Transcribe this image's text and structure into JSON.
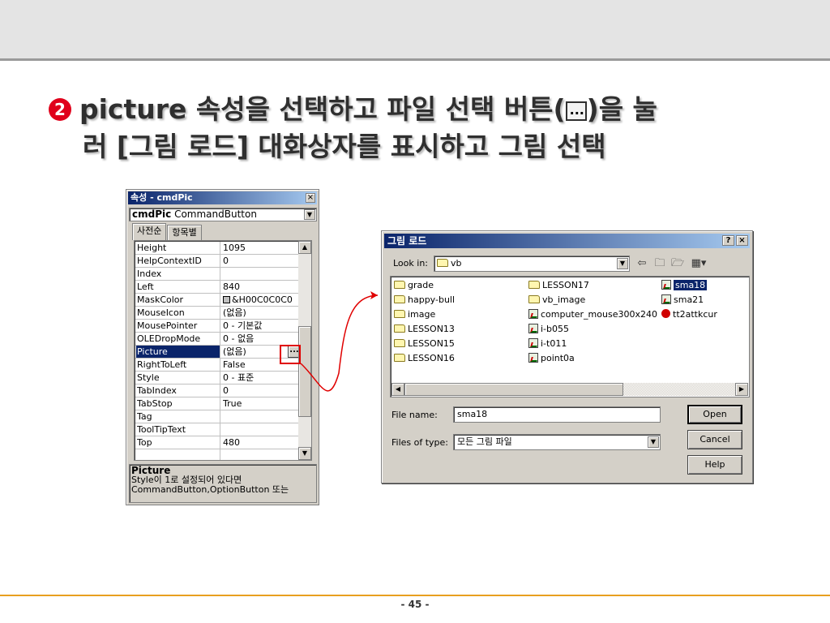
{
  "slide": {
    "bullet": "2",
    "title_part1": "picture 속성을 선택하고 파일 선택 버튼(",
    "title_part2": ")을 눌",
    "title_line2": "러 [그림 로드] 대화상자를 표시하고 그림 선택",
    "page_number": "- 45 -"
  },
  "props_window": {
    "title": "속성 - cmdPic",
    "close": "×",
    "object_name": "cmdPic",
    "object_type": "CommandButton",
    "tabs": [
      "사전순",
      "항목별"
    ],
    "properties": [
      {
        "name": "Height",
        "value": "1095"
      },
      {
        "name": "HelpContextID",
        "value": "0"
      },
      {
        "name": "Index",
        "value": ""
      },
      {
        "name": "Left",
        "value": "840"
      },
      {
        "name": "MaskColor",
        "value": "&H00C0C0C0"
      },
      {
        "name": "MouseIcon",
        "value": "(없음)"
      },
      {
        "name": "MousePointer",
        "value": "0 - 기본값"
      },
      {
        "name": "OLEDropMode",
        "value": "0 - 없음"
      },
      {
        "name": "Picture",
        "value": "(없음)"
      },
      {
        "name": "RightToLeft",
        "value": "False"
      },
      {
        "name": "Style",
        "value": "0 - 표준"
      },
      {
        "name": "TabIndex",
        "value": "0"
      },
      {
        "name": "TabStop",
        "value": "True"
      },
      {
        "name": "Tag",
        "value": ""
      },
      {
        "name": "ToolTipText",
        "value": ""
      },
      {
        "name": "Top",
        "value": "480"
      }
    ],
    "ellipsis": "...",
    "desc_title": "Picture",
    "desc_line1": "Style이 1로 설정되어 있다면",
    "desc_line2": "CommandButton,OptionButton 또는"
  },
  "dialog": {
    "title": "그림 로드",
    "help_btn": "?",
    "close_btn": "×",
    "look_in_label": "Look in:",
    "look_in_value": "vb",
    "files": [
      {
        "name": "grade",
        "type": "folder"
      },
      {
        "name": "happy-bull",
        "type": "folder"
      },
      {
        "name": "image",
        "type": "folder"
      },
      {
        "name": "LESSON13",
        "type": "folder"
      },
      {
        "name": "LESSON15",
        "type": "folder"
      },
      {
        "name": "LESSON16",
        "type": "folder"
      },
      {
        "name": "LESSON17",
        "type": "folder"
      },
      {
        "name": "vb_image",
        "type": "folder"
      },
      {
        "name": "computer_mouse300x240",
        "type": "image"
      },
      {
        "name": "i-b055",
        "type": "image"
      },
      {
        "name": "i-t011",
        "type": "image"
      },
      {
        "name": "point0a",
        "type": "image"
      },
      {
        "name": "sma18",
        "type": "image",
        "selected": true
      },
      {
        "name": "sma21",
        "type": "image"
      },
      {
        "name": "tt2attkcur",
        "type": "cursor"
      }
    ],
    "file_name_label": "File name:",
    "file_name_value": "sma18",
    "files_of_type_label": "Files of type:",
    "files_of_type_value": "모든 그림 파일",
    "open_btn": "Open",
    "cancel_btn": "Cancel",
    "help_button": "Help"
  },
  "colors": {
    "title_bar": "#0a246a",
    "highlight_box": "#e00000",
    "bullet": "#e0001b",
    "footer_line": "#e8a020"
  }
}
